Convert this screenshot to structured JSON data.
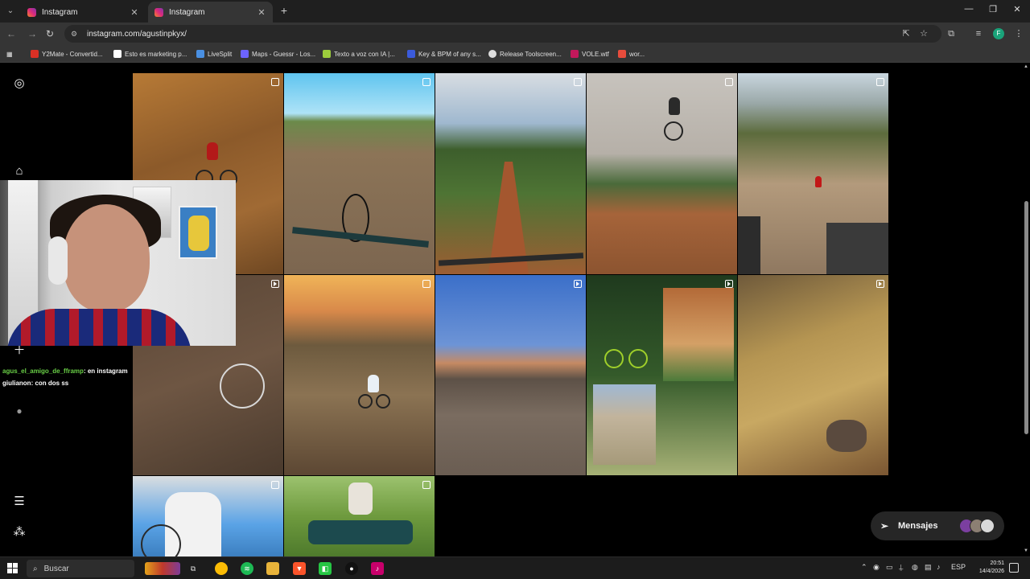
{
  "browser": {
    "tabs": [
      {
        "title": "Instagram",
        "active": false
      },
      {
        "title": "Instagram",
        "active": true
      }
    ],
    "url": "instagram.com/agustinpkyx/",
    "bookmarks": [
      {
        "label": "Y2Mate - Convertid...",
        "color": "#d93025"
      },
      {
        "label": "Esto es marketing p...",
        "color": "#ffffff"
      },
      {
        "label": "LiveSplit",
        "color": "#4a90e2"
      },
      {
        "label": "Maps - Guessr - Los...",
        "color": "#6c63ff"
      },
      {
        "label": "Texto a voz con IA |...",
        "color": "#9ccc3c"
      },
      {
        "label": "Key & BPM of any s...",
        "color": "#3b5bdb"
      },
      {
        "label": "Release Toolscreen...",
        "color": "#dddddd"
      },
      {
        "label": "VOLE.wtf",
        "color": "#c2185b"
      },
      {
        "label": "wor...",
        "color": "#e74c3c"
      }
    ]
  },
  "stream_overlay": {
    "chat": [
      {
        "user": "agus_el_amigo_de_fframp",
        "message": ": en instagram"
      },
      {
        "user": "giulianon",
        "message": ": con dos ss"
      }
    ]
  },
  "messages": {
    "label": "Mensajes"
  },
  "posts": [
    {
      "type": "carousel",
      "scene": "rider in red jacket on dirt trail"
    },
    {
      "type": "carousel",
      "scene": "POV handlebars on dirt jump"
    },
    {
      "type": "carousel",
      "scene": "POV red dirt path through green trees"
    },
    {
      "type": "carousel",
      "scene": "rider jumping over dirt ramp"
    },
    {
      "type": "carousel",
      "scene": "dirt park with wooden ramps"
    },
    {
      "type": "reel",
      "scene": "rider on dark dirt slope"
    },
    {
      "type": "carousel",
      "scene": "rider at sunset on dry trail"
    },
    {
      "type": "reel",
      "scene": "blue sky over dirt trail"
    },
    {
      "type": "reel",
      "scene": "collage of green mountain bikes"
    },
    {
      "type": "reel",
      "scene": "dry grass and rocky trail"
    },
    {
      "type": "carousel",
      "scene": "rider with helmet by teal bike"
    },
    {
      "type": "carousel",
      "scene": "bike number plate on grass"
    }
  ],
  "taskbar": {
    "search_placeholder": "Buscar",
    "language": "ESP",
    "time": "20:51",
    "date": "14/4/2026"
  }
}
